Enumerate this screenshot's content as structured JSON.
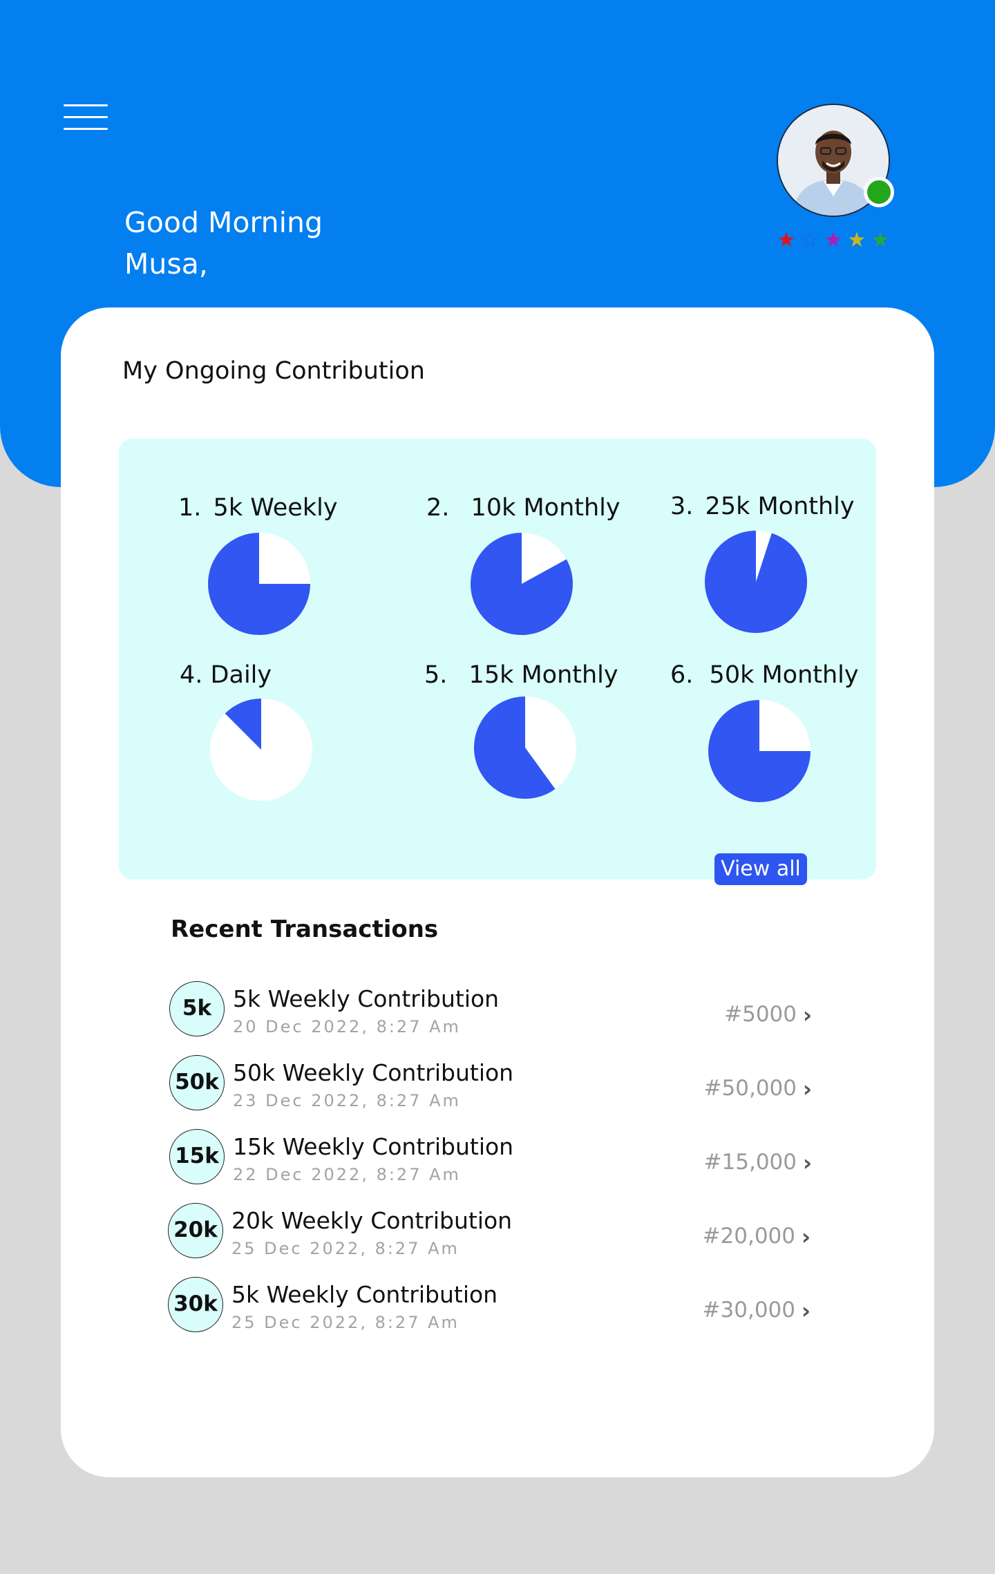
{
  "header": {
    "greeting_line1": "Good Morning",
    "greeting_line2": "Musa,",
    "background_color": "#037ff0",
    "status_color": "#23a61c",
    "rating_stars": [
      {
        "glyph": "★",
        "color": "#e0141d"
      },
      {
        "glyph": "☆",
        "color": "#2e58f0"
      },
      {
        "glyph": "★",
        "color": "#b21ab8"
      },
      {
        "glyph": "★",
        "color": "#c7b71a"
      },
      {
        "glyph": "★",
        "color": "#2aa83a"
      }
    ]
  },
  "contributions": {
    "title": "My Ongoing Contribution",
    "pie_color": "#3156f2",
    "pie_bg": "#ffffff",
    "items": [
      {
        "num": "1.",
        "label": "5k Weekly",
        "progress": 0.75
      },
      {
        "num": "2.",
        "label": "10k Monthly",
        "progress": 0.83
      },
      {
        "num": "3.",
        "label": "25k Monthly",
        "progress": 0.95
      },
      {
        "num": "4.",
        "label": "Daily",
        "progress": 0.125
      },
      {
        "num": "5.",
        "label": "15k Monthly",
        "progress": 0.6
      },
      {
        "num": "6.",
        "label": "50k Monthly",
        "progress": 0.75
      }
    ],
    "view_all_label": "View all"
  },
  "transactions": {
    "title": "Recent Transactions",
    "items": [
      {
        "badge": "5k",
        "title": "5k Weekly Contribution",
        "date": "20 Dec 2022, 8:27 Am",
        "amount": "#5000"
      },
      {
        "badge": "50k",
        "title": "50k Weekly Contribution",
        "date": "23 Dec 2022, 8:27 Am",
        "amount": "#50,000"
      },
      {
        "badge": "15k",
        "title": "15k Weekly Contribution",
        "date": "22 Dec 2022, 8:27 Am",
        "amount": "#15,000"
      },
      {
        "badge": "20k",
        "title": "20k Weekly Contribution",
        "date": "25 Dec 2022, 8:27 Am",
        "amount": "#20,000"
      },
      {
        "badge": "30k",
        "title": "5k Weekly Contribution",
        "date": "25 Dec 2022, 8:27 Am",
        "amount": "#30,000"
      }
    ],
    "chevron": "›"
  }
}
